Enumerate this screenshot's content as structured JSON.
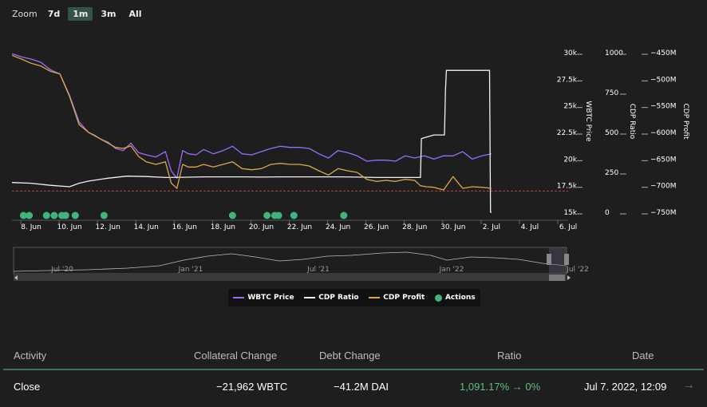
{
  "zoom": {
    "label": "Zoom",
    "options": [
      "7d",
      "1m",
      "3m",
      "All"
    ],
    "active": "1m"
  },
  "colors": {
    "wbtc": "#9b6bff",
    "cdp_ratio": "#f2f2f2",
    "cdp_profit": "#d9a84a",
    "actions": "#3fb57b",
    "liq_line": "#c04040",
    "axis_text": "#ffffff"
  },
  "chart_data": {
    "type": "line",
    "x_ticks": [
      "8. Jun",
      "10. Jun",
      "12. Jun",
      "14. Jun",
      "16. Jun",
      "18. Jun",
      "20. Jun",
      "22. Jun",
      "24. Jun",
      "26. Jun",
      "28. Jun",
      "30. Jun",
      "2. Jul",
      "4. Jul",
      "6. Jul"
    ],
    "x_start": "2022-06-07",
    "y_axes": [
      {
        "title": "WBTC Price",
        "ticks": [
          "30k",
          "27.5k",
          "25k",
          "22.5k",
          "20k",
          "17.5k",
          "15k"
        ],
        "range": [
          15000,
          30000
        ]
      },
      {
        "title": "CDP Ratio",
        "ticks": [
          "1000",
          "750",
          "500",
          "250",
          "0"
        ],
        "range": [
          0,
          1125
        ]
      },
      {
        "title": "CDP Profit",
        "ticks": [
          "−450M",
          "−500M",
          "−550M",
          "−600M",
          "−650M",
          "−700M",
          "−750M"
        ],
        "range": [
          -750,
          -450
        ]
      }
    ],
    "series": [
      {
        "name": "WBTC Price",
        "x": [
          7.0,
          7.5,
          8.0,
          8.5,
          9.0,
          9.5,
          10.0,
          10.5,
          11.0,
          11.3,
          11.6,
          12.0,
          12.4,
          12.8,
          13.2,
          13.6,
          14.0,
          14.5,
          15.0,
          15.3,
          15.6,
          15.9,
          16.2,
          16.6,
          17.0,
          17.5,
          18.0,
          18.5,
          19.0,
          19.5,
          20.0,
          20.5,
          21.0,
          21.5,
          22.0,
          22.5,
          23.0,
          23.5,
          24.0,
          24.5,
          25.0,
          25.5,
          26.0,
          26.5,
          27.0,
          27.5,
          28.0,
          28.5,
          29.0,
          29.5,
          30.0,
          30.5,
          31.0,
          31.5,
          32.0
        ],
        "y": [
          29900,
          29600,
          29400,
          29100,
          28400,
          28000,
          26000,
          23500,
          22500,
          22200,
          21900,
          21600,
          21000,
          20800,
          21500,
          20600,
          20400,
          20200,
          20700,
          18900,
          18200,
          20800,
          20500,
          20400,
          20900,
          20500,
          20800,
          21200,
          20500,
          20400,
          20700,
          21000,
          21200,
          21100,
          21100,
          21000,
          20500,
          20100,
          20800,
          20600,
          20300,
          19800,
          19900,
          19900,
          19800,
          20300,
          20100,
          20300,
          20000,
          20300,
          20300,
          20700,
          20000,
          20300,
          20500
        ]
      },
      {
        "name": "CDP Ratio",
        "x": [
          7.0,
          8.0,
          9.0,
          10.0,
          10.5,
          11.0,
          12.0,
          13.0,
          14.0,
          15.0,
          16.0,
          17.0,
          18.0,
          19.0,
          20.0,
          21.0,
          22.0,
          23.0,
          24.0,
          25.0,
          26.0,
          27.0,
          28.0,
          28.3,
          28.35,
          29.0,
          29.55,
          29.6,
          29.65,
          30.0,
          31.0,
          31.9,
          31.95,
          32.0
        ],
        "y": [
          210,
          205,
          190,
          180,
          205,
          220,
          240,
          255,
          252,
          245,
          247,
          250,
          250,
          250,
          248,
          250,
          250,
          250,
          250,
          248,
          245,
          245,
          245,
          245,
          520,
          545,
          545,
          850,
          1000,
          1000,
          1000,
          1000,
          0,
          0
        ]
      },
      {
        "name": "CDP Profit",
        "x": [
          7.0,
          7.5,
          8.0,
          8.5,
          9.0,
          9.5,
          10.0,
          10.5,
          11.0,
          11.3,
          11.6,
          12.0,
          12.4,
          12.8,
          13.2,
          13.6,
          14.0,
          14.5,
          15.0,
          15.3,
          15.6,
          15.9,
          16.2,
          16.6,
          17.0,
          17.5,
          18.0,
          18.5,
          19.0,
          19.5,
          20.0,
          20.5,
          21.0,
          21.5,
          22.0,
          22.5,
          23.0,
          23.5,
          24.0,
          24.5,
          25.0,
          25.5,
          26.0,
          26.5,
          27.0,
          27.5,
          28.0,
          28.3,
          28.6,
          29.0,
          29.5,
          30.0,
          30.5,
          31.0,
          31.5,
          32.0
        ],
        "y": [
          -455,
          -462,
          -470,
          -475,
          -485,
          -490,
          -532,
          -585,
          -600,
          -605,
          -612,
          -620,
          -628,
          -630,
          -625,
          -645,
          -655,
          -660,
          -655,
          -695,
          -705,
          -660,
          -665,
          -665,
          -660,
          -665,
          -660,
          -655,
          -668,
          -670,
          -668,
          -660,
          -658,
          -660,
          -660,
          -663,
          -672,
          -680,
          -668,
          -672,
          -675,
          -688,
          -692,
          -690,
          -692,
          -688,
          -690,
          -700,
          -702,
          -703,
          -708,
          -683,
          -705,
          -702,
          -703,
          -705
        ]
      }
    ],
    "actions_x": [
      7.6,
      7.9,
      8.8,
      9.2,
      9.6,
      9.8,
      10.3,
      11.8,
      18.5,
      20.3,
      20.7,
      20.9,
      21.7,
      24.3
    ],
    "liquidation_y": 17000,
    "navigator": {
      "labels": [
        "Jul '20",
        "Jan '21",
        "Jul '21",
        "Jan '22",
        "Jul '22"
      ]
    }
  },
  "legend": [
    {
      "label": "WBTC Price",
      "kind": "line",
      "color": "#9b6bff"
    },
    {
      "label": "CDP Ratio",
      "kind": "line",
      "color": "#f2f2f2"
    },
    {
      "label": "CDP Profit",
      "kind": "line",
      "color": "#d9a84a"
    },
    {
      "label": "Actions",
      "kind": "dot",
      "color": "#3fb57b"
    }
  ],
  "table": {
    "headers": [
      "Activity",
      "Collateral Change",
      "Debt Change",
      "Ratio",
      "Date"
    ],
    "rows": [
      {
        "activity": "Close",
        "collateral": "−21,962 WBTC",
        "debt": "−41.2M DAI",
        "ratio": "1,091.17% → 0%",
        "date": "Jul 7. 2022, 12:09",
        "arrow": "→"
      }
    ]
  }
}
